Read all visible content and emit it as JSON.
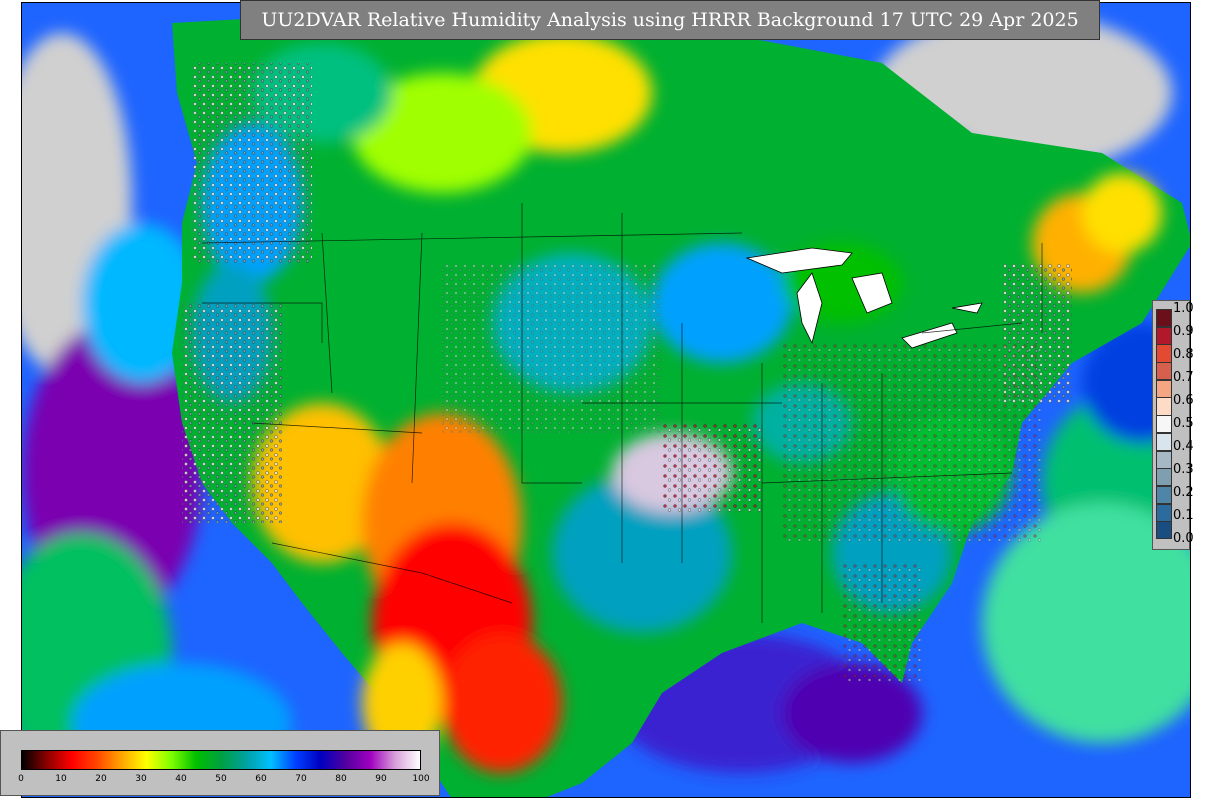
{
  "title": "UU2DVAR Relative Humidity Analysis using HRRR Background 17 UTC 29 Apr 2025",
  "colorbar_humidity": {
    "ticks": [
      "0",
      "10",
      "20",
      "30",
      "40",
      "50",
      "60",
      "70",
      "80",
      "90",
      "100"
    ],
    "range": [
      0,
      100
    ],
    "gradient_colors": [
      "#000000",
      "#8b0000",
      "#ff0000",
      "#ff4500",
      "#ffa500",
      "#ffff00",
      "#7fff00",
      "#00c000",
      "#00a040",
      "#00a0a0",
      "#00bfff",
      "#0040ff",
      "#0000c0",
      "#5000a0",
      "#a000c0",
      "#d8a0d8",
      "#ffffff"
    ]
  },
  "colorbar_obs": {
    "ticks": [
      "1.0",
      "0.9",
      "0.8",
      "0.7",
      "0.6",
      "0.5",
      "0.4",
      "0.3",
      "0.2",
      "0.1",
      "0.0"
    ],
    "colors": [
      "#6b0f1a",
      "#b2182b",
      "#e34a33",
      "#d6604d",
      "#f4a582",
      "#fddbc7",
      "#f7f7f7",
      "#d9e4ec",
      "#a6b8c4",
      "#7f9fb0",
      "#4f85a6",
      "#2b6b9e",
      "#1a4d80"
    ]
  }
}
